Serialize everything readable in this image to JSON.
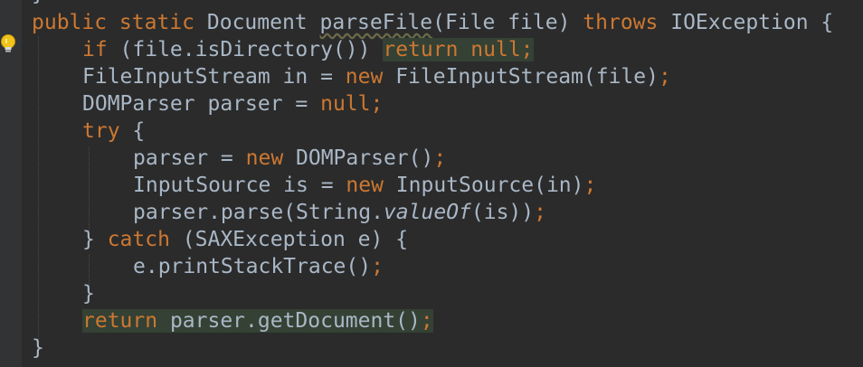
{
  "editor": {
    "lines": [
      {
        "segments": [
          {
            "t": "public static ",
            "c": "kw"
          },
          {
            "t": "Document ",
            "c": "plain"
          },
          {
            "t": "parseFile",
            "c": "warn-name"
          },
          {
            "t": "(File file) ",
            "c": "plain"
          },
          {
            "t": "throws ",
            "c": "kw"
          },
          {
            "t": "IOException {",
            "c": "plain"
          }
        ]
      },
      {
        "segments": [
          {
            "t": "if ",
            "c": "kw"
          },
          {
            "t": "(file.isDirectory()) ",
            "c": "plain"
          },
          {
            "t": "return null;",
            "c": "kw hl"
          }
        ]
      },
      {
        "segments": [
          {
            "t": "FileInputStream in = ",
            "c": "plain"
          },
          {
            "t": "new ",
            "c": "kw"
          },
          {
            "t": "FileInputStream(file)",
            "c": "plain"
          },
          {
            "t": ";",
            "c": "kw"
          }
        ]
      },
      {
        "segments": [
          {
            "t": "DOMParser parser = ",
            "c": "plain"
          },
          {
            "t": "null;",
            "c": "kw"
          }
        ]
      },
      {
        "segments": [
          {
            "t": "try ",
            "c": "kw"
          },
          {
            "t": "{",
            "c": "plain"
          }
        ]
      },
      {
        "segments": [
          {
            "t": "parser = ",
            "c": "plain"
          },
          {
            "t": "new ",
            "c": "kw"
          },
          {
            "t": "DOMParser()",
            "c": "plain"
          },
          {
            "t": ";",
            "c": "kw"
          }
        ]
      },
      {
        "segments": [
          {
            "t": "InputSource is = ",
            "c": "plain"
          },
          {
            "t": "new ",
            "c": "kw"
          },
          {
            "t": "InputSource(in)",
            "c": "plain"
          },
          {
            "t": ";",
            "c": "kw"
          }
        ]
      },
      {
        "segments": [
          {
            "t": "parser.parse(String.",
            "c": "plain"
          },
          {
            "t": "valueOf",
            "c": "plain italic"
          },
          {
            "t": "(is))",
            "c": "plain"
          },
          {
            "t": ";",
            "c": "kw"
          }
        ]
      },
      {
        "segments": [
          {
            "t": "} ",
            "c": "plain"
          },
          {
            "t": "catch ",
            "c": "kw"
          },
          {
            "t": "(SAXException e) {",
            "c": "plain"
          }
        ]
      },
      {
        "segments": [
          {
            "t": "e.printStackTrace()",
            "c": "plain"
          },
          {
            "t": ";",
            "c": "kw"
          }
        ]
      },
      {
        "segments": [
          {
            "t": "}",
            "c": "plain"
          }
        ]
      },
      {
        "segments": [
          {
            "t": "return ",
            "c": "kw hl"
          },
          {
            "t": "parser.getDocument()",
            "c": "plain hl"
          },
          {
            "t": ";",
            "c": "kw hl"
          }
        ]
      },
      {
        "segments": [
          {
            "t": "}",
            "c": "plain"
          }
        ]
      }
    ],
    "top_partial": "}",
    "icons": {
      "gutter": "lightbulb-icon"
    }
  }
}
